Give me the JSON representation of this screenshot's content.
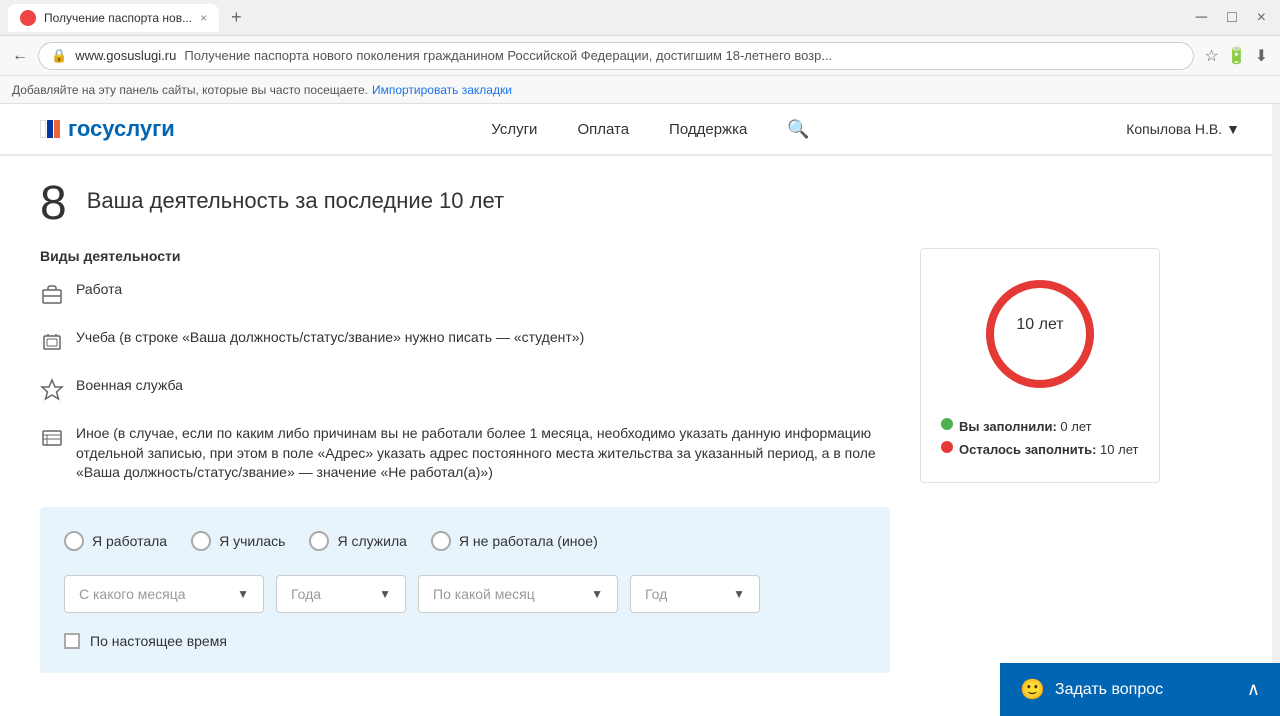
{
  "browser": {
    "tab_title": "Получение паспорта нов...",
    "tab_close": "×",
    "new_tab": "+",
    "win_minimize": "─",
    "win_restore": "□",
    "win_close": "×",
    "back_btn": "←",
    "address": "www.gosuslugi.ru",
    "page_title_bar": "Получение паспорта нового поколения гражданином Российской Федерации, достигшим 18-летнего возр...",
    "bookmark_btn": "☆",
    "download_icon": "⬇",
    "settings_icon": "⋮",
    "bookmarks_text": "Добавляйте на эту панель сайты, которые вы часто посещаете.",
    "bookmarks_link": "Импортировать закладки"
  },
  "header": {
    "logo_gos": "гос",
    "logo_uslugi": "услуги",
    "nav_items": [
      "Услуги",
      "Оплата",
      "Поддержка"
    ],
    "user_name": "Копылова Н.В.",
    "user_arrow": "▼"
  },
  "section": {
    "number": "8",
    "title": "Ваша деятельность за последние 10 лет"
  },
  "activity_types": {
    "label": "Виды деятельности",
    "items": [
      {
        "icon": "💼",
        "text": "Работа"
      },
      {
        "icon": "📖",
        "text": "Учеба (в строке «Ваша должность/статус/звание» нужно писать — «студент»)"
      },
      {
        "icon": "⭐",
        "text": "Военная служба"
      },
      {
        "icon": "📋",
        "text": "Иное (в случае, если по каким либо причинам вы не работали более 1 месяца, необходимо указать данную информацию отдельной записью, при этом в поле «Адрес» указать адрес постоянного места жительства за указанный период, а в поле «Ваша должность/статус/звание» — значение «Не работал(а)»)"
      }
    ]
  },
  "progress": {
    "total_years": "10 лет",
    "center_text": "10 лет",
    "filled_label": "Вы заполнили:",
    "filled_value": "0 лет",
    "remaining_label": "Осталось заполнить:",
    "remaining_value": "10 лет",
    "filled_percent": 0
  },
  "form": {
    "radio_options": [
      "Я работала",
      "Я училась",
      "Я служила",
      "Я не работала (иное)"
    ],
    "from_month_placeholder": "С какого месяца",
    "from_year_placeholder": "Года",
    "to_month_placeholder": "По какой месяц",
    "to_year_placeholder": "Год",
    "present_checkbox_label": "По настоящее время",
    "arrow": "▼"
  },
  "ask_button": {
    "icon": "🙂",
    "label": "Задать вопрос",
    "expand": "∧"
  }
}
